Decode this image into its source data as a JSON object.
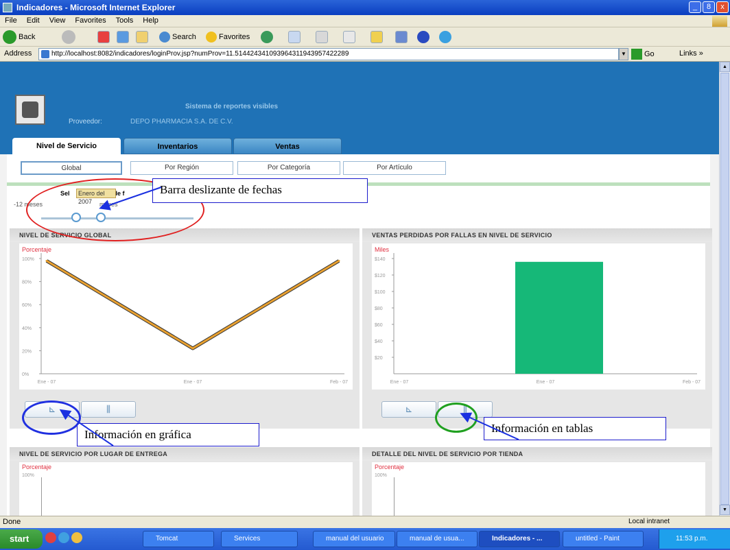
{
  "window": {
    "title": "Indicadores - Microsoft Internet Explorer",
    "min": "_",
    "max": "8",
    "close": "x"
  },
  "menu": [
    "File",
    "Edit",
    "View",
    "Favorites",
    "Tools",
    "Help"
  ],
  "toolbar": {
    "back": "Back",
    "search": "Search",
    "favorites": "Favorites"
  },
  "address": {
    "label": "Address",
    "url": "http://localhost:8082/indicadores/loginProv.jsp?numProv=11.514424341093964311943957422289",
    "go": "Go",
    "links": "Links"
  },
  "site": {
    "title": "Sistema de reportes visibles",
    "provider_label": "Proveedor:",
    "provider_name": "DEPO PHARMACIA S.A. DE C.V."
  },
  "tabs": [
    "Nivel de Servicio",
    "Inventarios",
    "Ventas"
  ],
  "subtabs": [
    "Global",
    "Por Región",
    "Por Categoría",
    "Por Artículo"
  ],
  "slider": {
    "select_prefix": "Sel",
    "tooltip": "Enero del 2007",
    "select_suffix": "de f",
    "min_label": "-12 meses",
    "max_label": "meses"
  },
  "panels": {
    "p1": {
      "title": "NIVEL DE SERVICIO GLOBAL",
      "ylabel": "Porcentaje"
    },
    "p2": {
      "title": "VENTAS PERDIDAS POR FALLAS EN NIVEL DE SERVICIO",
      "ylabel": "Miles"
    },
    "p3": {
      "title": "NIVEL DE SERVICIO POR LUGAR DE ENTREGA",
      "ylabel": "Porcentaje",
      "tick": "100%"
    },
    "p4": {
      "title": "DETALLE DEL NIVEL DE SERVICIO POR TIENDA",
      "ylabel": "Porcentaje",
      "tick": "100%"
    }
  },
  "buttons": {
    "chart": "⊾",
    "table": "⫼"
  },
  "callouts": {
    "slider": "Barra deslizante de fechas",
    "chart": "Información en gráfica",
    "table": "Información en tablas"
  },
  "chart_data": [
    {
      "type": "line",
      "title": "NIVEL DE SERVICIO GLOBAL",
      "ylabel": "Porcentaje",
      "categories": [
        "Ene - 07",
        "Ene - 07",
        "Feb - 07"
      ],
      "series": [
        {
          "values": [
            98,
            22,
            98
          ]
        }
      ],
      "yticks": [
        "0%",
        "20%",
        "40%",
        "60%",
        "80%",
        "100%"
      ],
      "ylim": [
        0,
        100
      ],
      "color": "#e8a030"
    },
    {
      "type": "bar",
      "title": "VENTAS PERDIDAS POR FALLAS EN NIVEL DE SERVICIO",
      "ylabel": "Miles",
      "categories": [
        "Ene - 07",
        "Ene - 07",
        "Feb - 07"
      ],
      "values": [
        null,
        136,
        null
      ],
      "yticks": [
        "$20",
        "$40",
        "$60",
        "$80",
        "$100",
        "$120",
        "$140"
      ],
      "ylim": [
        0,
        140
      ],
      "color": "#16b878"
    }
  ],
  "status": {
    "done": "Done",
    "zone": "Local intranet"
  },
  "taskbar": {
    "start": "start",
    "tasks": [
      "Tomcat",
      "Services",
      "manual del usuario",
      "manual de usua...",
      "Indicadores - ...",
      "untitled - Paint"
    ],
    "clock": "11:53 p.m."
  }
}
